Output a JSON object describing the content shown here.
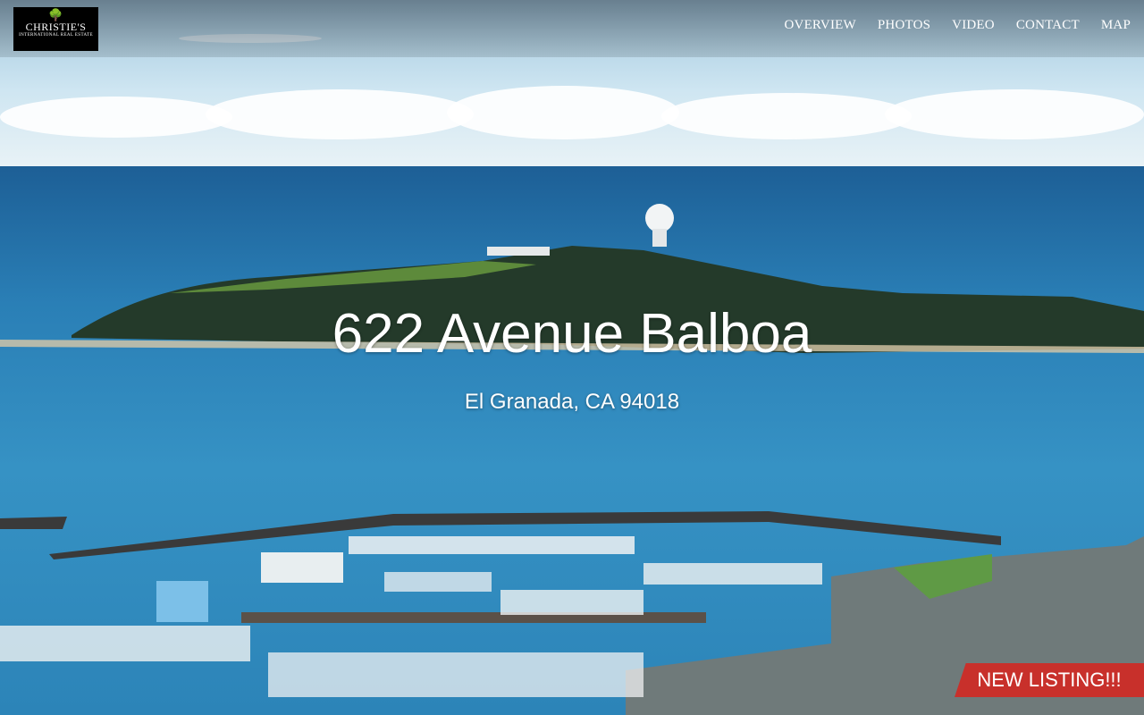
{
  "logo": {
    "brand": "CHRISTIE'S",
    "subtitle": "INTERNATIONAL REAL ESTATE",
    "icon": "tree-icon"
  },
  "nav": {
    "items": [
      {
        "label": "OVERVIEW"
      },
      {
        "label": "PHOTOS"
      },
      {
        "label": "VIDEO"
      },
      {
        "label": "CONTACT"
      },
      {
        "label": "MAP"
      }
    ]
  },
  "hero": {
    "title": "622 Avenue Balboa",
    "subtitle": "El Granada, CA 94018"
  },
  "badge": {
    "label": "NEW LISTING!!!",
    "color": "#c8302b"
  }
}
